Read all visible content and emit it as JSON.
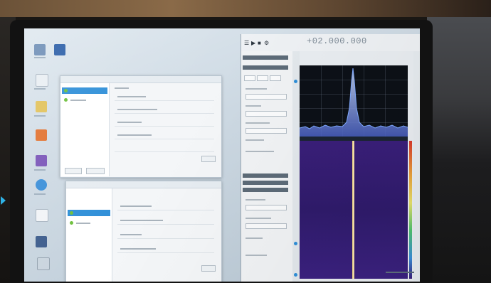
{
  "photo": {
    "subject": "laptop",
    "accent_color": "#2fb3e6"
  },
  "sdr_app": {
    "frequency_readout": "+02.000.000",
    "toolbar_icons": [
      "menu-icon",
      "play-icon",
      "stop-icon",
      "settings-icon"
    ],
    "colors": {
      "spectrum_bg": "#0c1017",
      "waterfall_bg": "#3a1f7a",
      "trace": "#7fa9ff",
      "carrier": "#fff2c9"
    }
  }
}
